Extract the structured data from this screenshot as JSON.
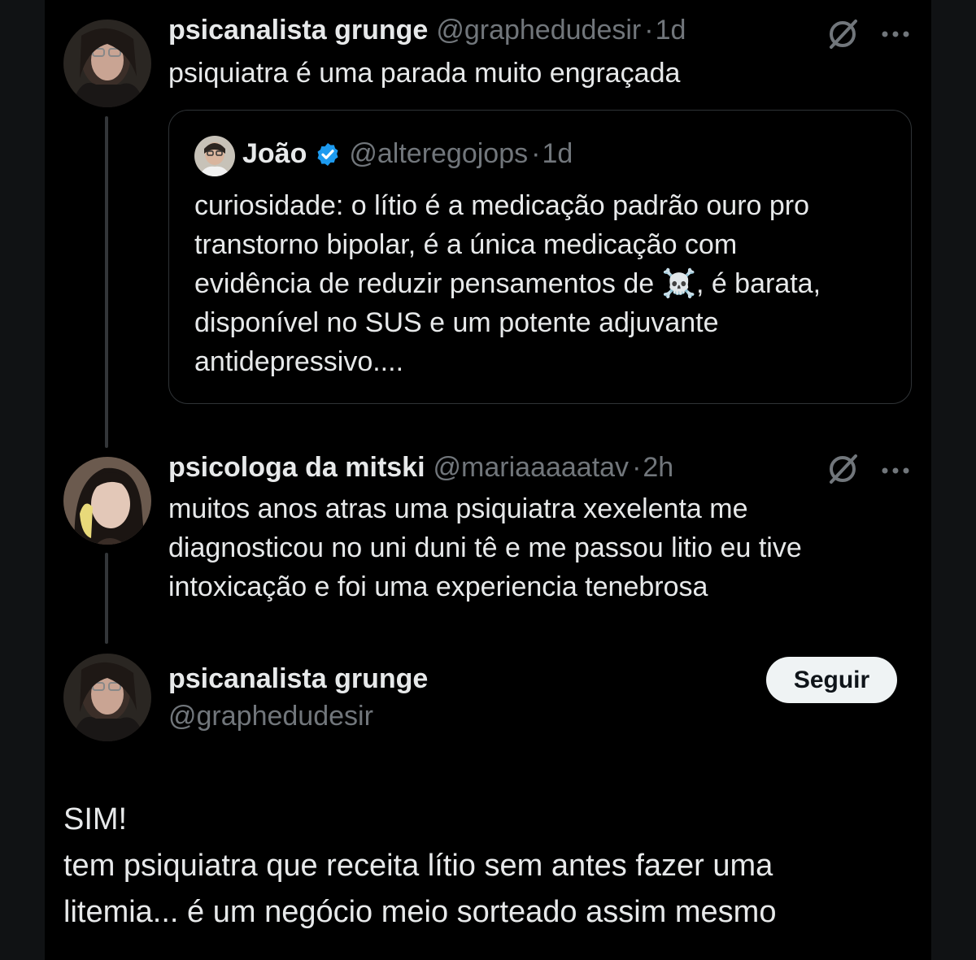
{
  "tweet1": {
    "name": "psicanalista grunge",
    "handle": "@graphedudesir",
    "sep": "·",
    "time": "1d",
    "text": "psiquiatra é uma parada muito engraçada",
    "icons": [
      "grok-icon",
      "more-icon"
    ]
  },
  "quote": {
    "name": "João",
    "handle": "@alteregojops",
    "sep": "·",
    "time": "1d",
    "lines": [
      "curiosidade: o lítio é a medicação padrão ouro pro",
      "transtorno bipolar, é a única medicação com",
      "evidência de reduzir pensamentos de",
      "☠️",
      ", é barata,",
      "disponível no SUS e um potente adjuvante",
      "antidepressivo...."
    ],
    "verified_color": "#1d9bf0"
  },
  "tweet2": {
    "name": "psicologa da mitski",
    "handle": "@mariaaaaatav",
    "sep": "·",
    "time": "2h",
    "lines": [
      "muitos anos atras uma psiquiatra xexelenta me",
      "diagnosticou no uni duni tê e me passou litio eu tive",
      "intoxicação e foi uma experiencia tenebrosa"
    ]
  },
  "main": {
    "name": "psicanalista grunge",
    "handle": "@graphedudesir",
    "follow_label": "Seguir",
    "lines": [
      "SIM!",
      "tem psiquiatra que receita lítio sem antes fazer uma",
      "litemia... é um negócio meio sorteado assim mesmo"
    ]
  },
  "colors": {
    "background": "#000000",
    "text": "#e7e9ea",
    "muted": "#71767b",
    "border": "#2f3336"
  }
}
